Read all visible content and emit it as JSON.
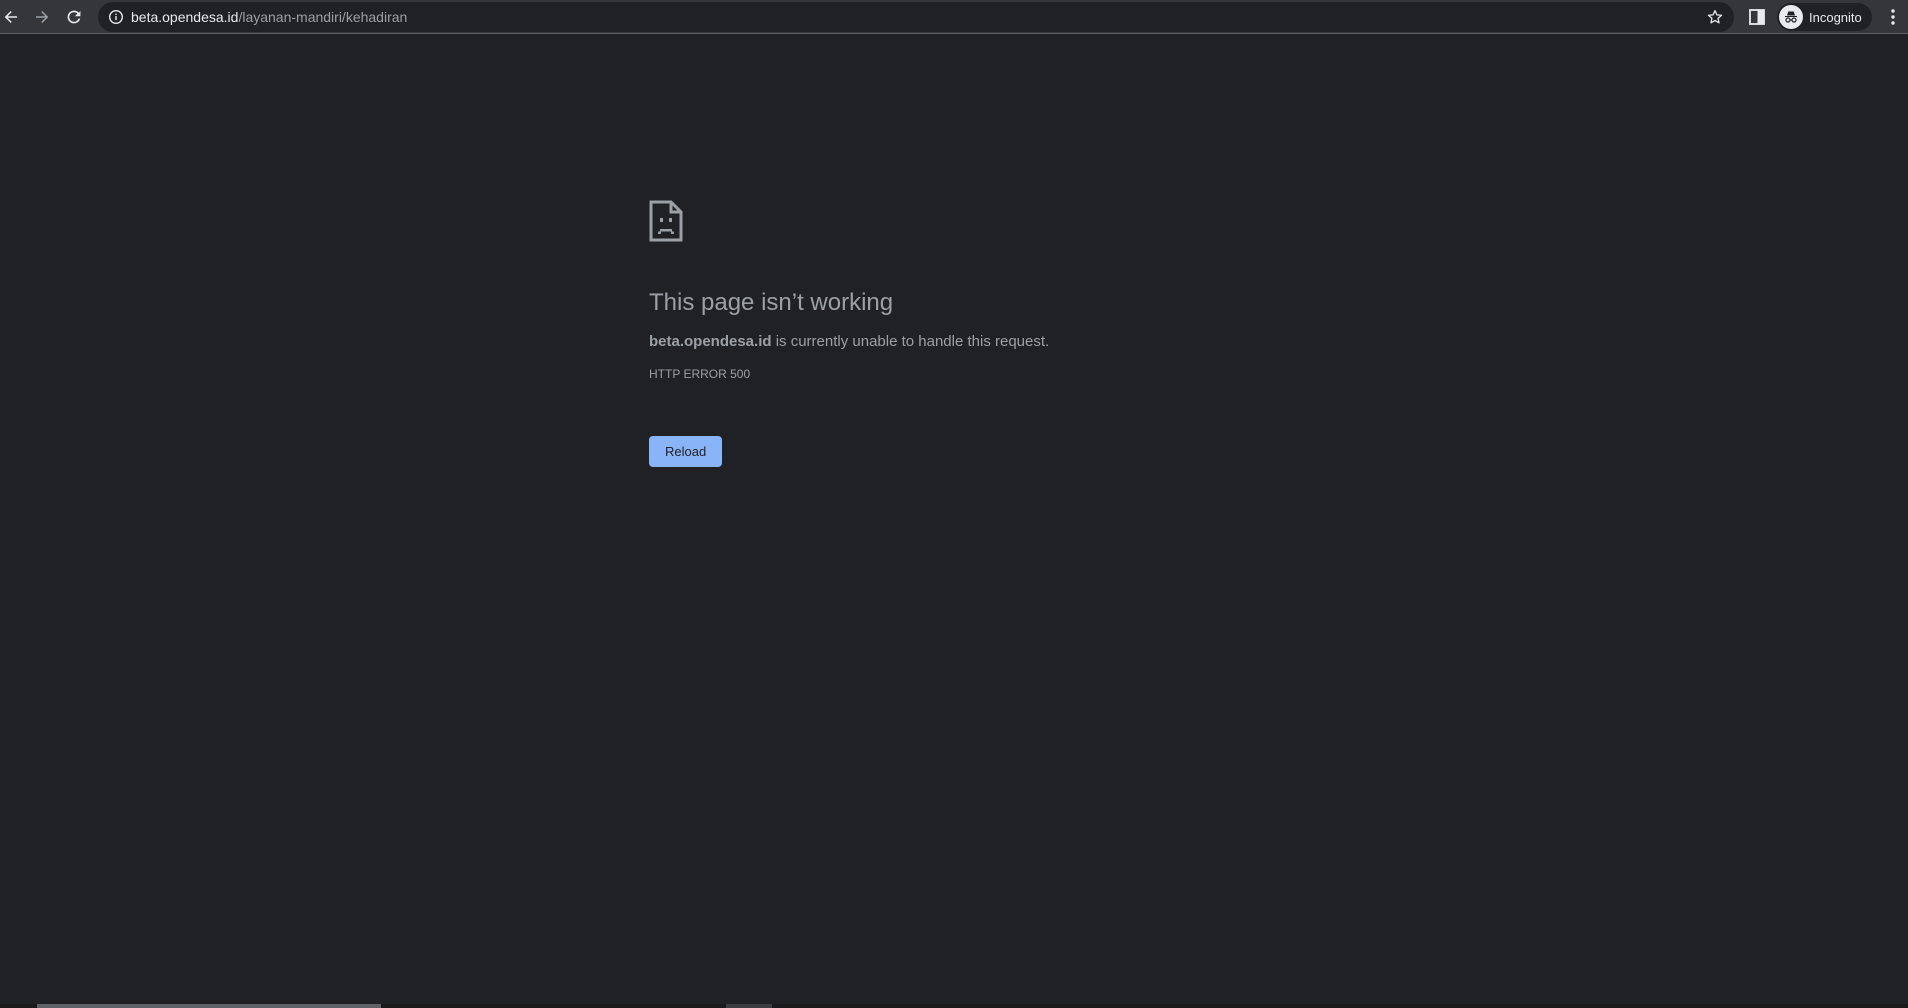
{
  "browser": {
    "url_host": "beta.opendesa.id",
    "url_path": "/layanan-mandiri/kehadiran",
    "profile_label": "Incognito"
  },
  "error": {
    "title": "This page isn’t working",
    "host": "beta.opendesa.id",
    "description_rest": " is currently unable to handle this request.",
    "code": "HTTP ERROR 500",
    "reload_label": "Reload"
  },
  "colors": {
    "page_background": "#202124",
    "toolbar": "#35363a",
    "text_secondary": "#9aa0a6",
    "button_accent": "#8ab4f8"
  },
  "icons": {
    "back": "back-arrow-icon",
    "forward": "forward-arrow-icon",
    "reload": "reload-icon",
    "info": "info-icon",
    "bookmark": "star-icon",
    "side_panel": "side-panel-icon",
    "incognito": "incognito-icon",
    "menu": "kebab-menu-icon",
    "error": "sad-page-icon"
  }
}
